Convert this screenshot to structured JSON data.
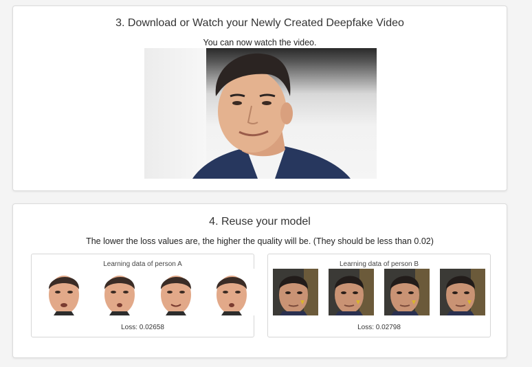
{
  "download_section": {
    "title": "3. Download or Watch your Newly Created Deepfake Video",
    "subtitle": "You can now watch the video."
  },
  "reuse_section": {
    "title": "4. Reuse your model",
    "subtitle": "The lower the loss values are, the higher the quality will be. (They should be less than 0.02)",
    "panels": [
      {
        "label": "Learning data of person A",
        "loss": "Loss: 0.02658"
      },
      {
        "label": "Learning data of person B",
        "loss": "Loss: 0.02798"
      }
    ]
  },
  "colors": {
    "page_background": "#f4f4f4",
    "card_background": "#ffffff",
    "card_border": "#dcdcdc",
    "suit": "#27375e"
  }
}
